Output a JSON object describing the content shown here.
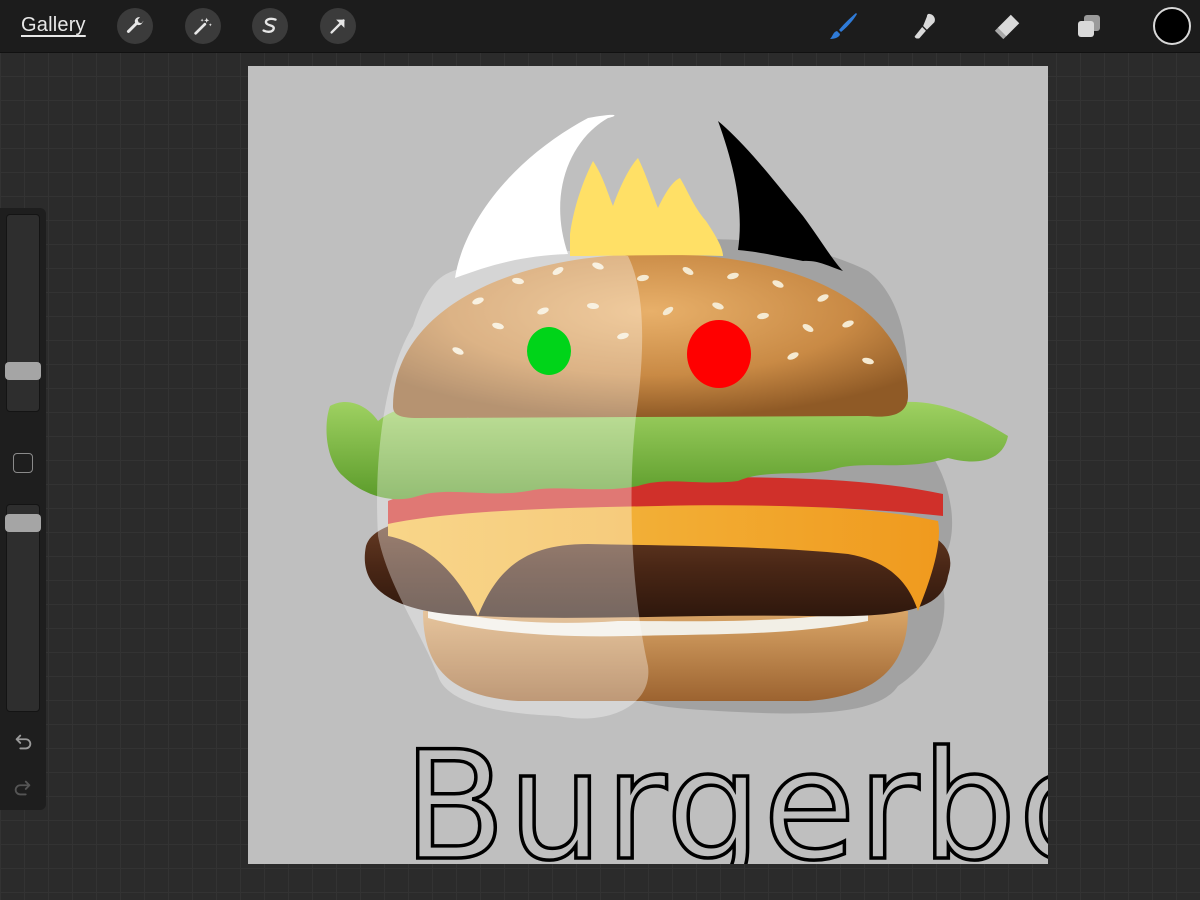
{
  "app": {
    "gallery_label": "Gallery"
  },
  "toolbar": {
    "left_tools": [
      "wrench-icon",
      "magic-wand-icon",
      "selection-s-icon",
      "transform-arrow-icon"
    ],
    "right_tools": [
      "brush-icon",
      "smudge-icon",
      "eraser-icon",
      "layers-icon"
    ],
    "active_tool": "brush",
    "accent_color": "#2f7bd8",
    "current_color": "#000000"
  },
  "sidebar": {
    "brush_size_level": 0.18,
    "opacity_level": 0.95,
    "undo_icon": "undo-arrow-icon",
    "redo_icon": "redo-arrow-icon"
  },
  "canvas": {
    "background_color": "#bfbfbf",
    "handwritten_text": "Burgerboo",
    "stroke_colors": {
      "white_horn": "#ffffff",
      "crown": "#ffe066",
      "black_horn": "#000000",
      "left_eye": "#00d419",
      "right_eye": "#ff0000"
    }
  }
}
